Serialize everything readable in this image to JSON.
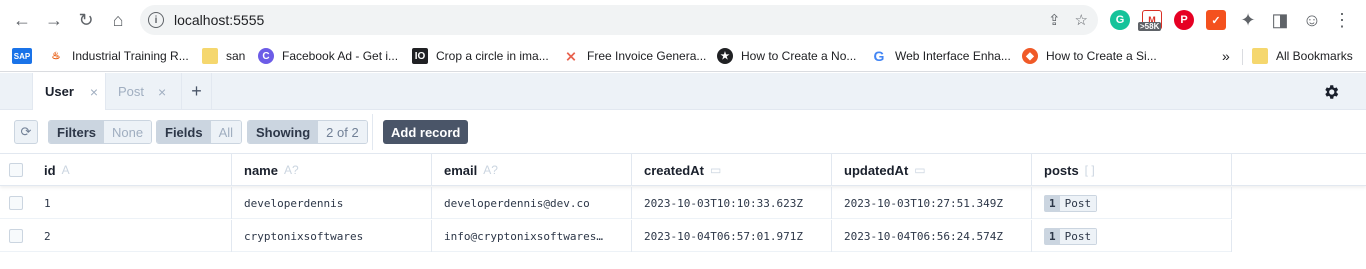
{
  "browser": {
    "url": "localhost:5555",
    "extension_badge": ">58K",
    "bookmarks": [
      {
        "label": "Industrial Training R...",
        "icon": "flame-icon"
      },
      {
        "label": "san",
        "icon": "folder-icon"
      },
      {
        "label": "Facebook Ad - Get i...",
        "icon": "circle-c-icon"
      },
      {
        "label": "Crop a circle in ima...",
        "icon": "io-icon"
      },
      {
        "label": "Free Invoice Genera...",
        "icon": "chevron-logo-icon"
      },
      {
        "label": "How to Create a No...",
        "icon": "star-badge-icon"
      },
      {
        "label": "Web Interface Enha...",
        "icon": "google-icon"
      },
      {
        "label": "How to Create a Si...",
        "icon": "shield-logo-icon"
      }
    ],
    "overflow_label": "»",
    "all_bookmarks": "All Bookmarks"
  },
  "studio": {
    "tabs": [
      {
        "label": "User",
        "close": "×",
        "active": true
      },
      {
        "label": "Post",
        "close": "×",
        "active": false
      }
    ],
    "add_tab": "+",
    "toolbar": {
      "filters_label": "Filters",
      "filters_value": "None",
      "fields_label": "Fields",
      "fields_value": "All",
      "showing_label": "Showing",
      "showing_value": "2 of 2",
      "add_record": "Add record"
    },
    "columns": [
      {
        "name": "id",
        "type": "A"
      },
      {
        "name": "name",
        "type": "A?"
      },
      {
        "name": "email",
        "type": "A?"
      },
      {
        "name": "createdAt",
        "type": "▭"
      },
      {
        "name": "updatedAt",
        "type": "▭"
      },
      {
        "name": "posts",
        "type": "[ ]"
      }
    ],
    "rows": [
      {
        "id": "1",
        "name": "developerdennis",
        "email": "developerdennis@dev.co",
        "createdAt": "2023-10-03T10:10:33.623Z",
        "updatedAt": "2023-10-03T10:27:51.349Z",
        "posts_count": "1",
        "posts_label": "Post"
      },
      {
        "id": "2",
        "name": "cryptonixsoftwares",
        "email": "info@cryptonixsoftwares…",
        "createdAt": "2023-10-04T06:57:01.971Z",
        "updatedAt": "2023-10-04T06:56:24.574Z",
        "posts_count": "1",
        "posts_label": "Post"
      }
    ]
  }
}
